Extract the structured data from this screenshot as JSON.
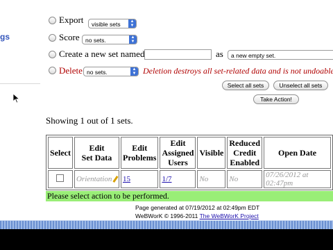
{
  "sidebar": {
    "link_fragment": "gs"
  },
  "form": {
    "export": {
      "label": "Export",
      "select": "visible sets"
    },
    "score": {
      "label": "Score",
      "select": "no sets."
    },
    "create": {
      "label": "Create a new set named:",
      "as_label": "as",
      "select": "a new empty set."
    },
    "delete": {
      "label": "Delete",
      "select": "no sets.",
      "warning": "Deletion destroys all set-related data and is not undoable"
    },
    "buttons": {
      "select_all": "Select all sets",
      "unselect_all": "Unselect all sets",
      "take_action": "Take Action!"
    }
  },
  "showing": "Showing 1 out of 1 sets.",
  "table": {
    "headers": {
      "select": "Select",
      "edit_set_data_1": "Edit",
      "edit_set_data_2": "Set Data",
      "edit_problems_1": "Edit",
      "edit_problems_2": "Problems",
      "edit_users_1": "Edit",
      "edit_users_2": "Assigned",
      "edit_users_3": "Users",
      "visible": "Visible",
      "reduced_1": "Reduced",
      "reduced_2": "Credit",
      "reduced_3": "Enabled",
      "open_date": "Open Date"
    },
    "row": {
      "set_name": "Orientation",
      "problems": "15",
      "users": "1/7",
      "visible": "No",
      "reduced": "No",
      "open_date": "07/26/2012 at 02:47pm"
    }
  },
  "message": "Please select action to be performed.",
  "footer": {
    "generated": "Page generated at 07/19/2012 at 02:49pm EDT",
    "copyright": "WeBWorK © 1996-2011",
    "project_link": "The WeBWorK Project"
  },
  "colors": {
    "message_bg": "#99ee77",
    "warning": "#b00000",
    "dock": "#6a8fd0"
  },
  "icons": [
    "pencil-icon",
    "mouse-cursor-icon"
  ]
}
